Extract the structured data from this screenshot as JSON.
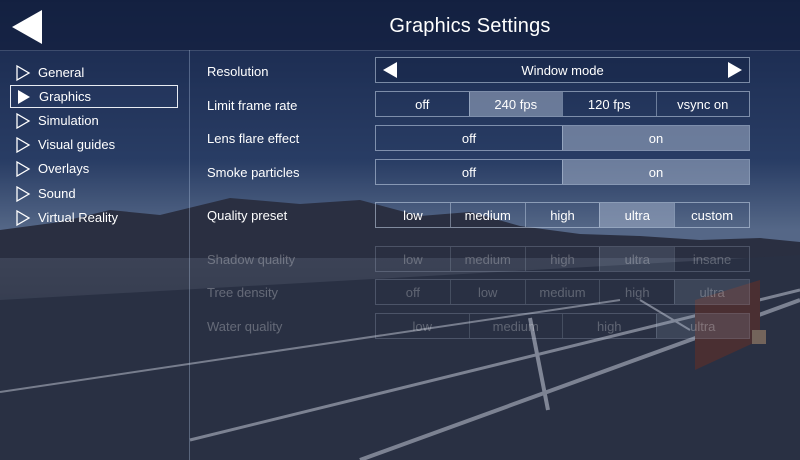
{
  "header": {
    "title": "Graphics Settings",
    "back_icon": "back-arrow-icon"
  },
  "sidebar": {
    "items": [
      {
        "label": "General",
        "selected": false
      },
      {
        "label": "Graphics",
        "selected": true
      },
      {
        "label": "Simulation",
        "selected": false
      },
      {
        "label": "Visual guides",
        "selected": false
      },
      {
        "label": "Overlays",
        "selected": false
      },
      {
        "label": "Sound",
        "selected": false
      },
      {
        "label": "Virtual Reality",
        "selected": false
      }
    ]
  },
  "settings": {
    "resolution": {
      "label": "Resolution",
      "value": "Window mode",
      "prev_icon": "left-arrow-icon",
      "next_icon": "right-arrow-icon"
    },
    "frame_rate": {
      "label": "Limit frame rate",
      "options": [
        "off",
        "240 fps",
        "120 fps",
        "vsync on"
      ],
      "selected": "240 fps"
    },
    "lens_flare": {
      "label": "Lens flare effect",
      "options": [
        "off",
        "on"
      ],
      "selected": "on"
    },
    "smoke": {
      "label": "Smoke particles",
      "options": [
        "off",
        "on"
      ],
      "selected": "on"
    },
    "quality_preset": {
      "label": "Quality preset",
      "options": [
        "low",
        "medium",
        "high",
        "ultra",
        "custom"
      ],
      "selected": "ultra"
    },
    "shadow_quality": {
      "label": "Shadow quality",
      "options": [
        "low",
        "medium",
        "high",
        "ultra",
        "insane"
      ],
      "selected": "ultra",
      "disabled": true
    },
    "tree_density": {
      "label": "Tree density",
      "options": [
        "off",
        "low",
        "medium",
        "high",
        "ultra"
      ],
      "selected": "ultra",
      "disabled": true
    },
    "water_quality": {
      "label": "Water quality",
      "options": [
        "low",
        "medium",
        "high",
        "ultra"
      ],
      "selected": "ultra",
      "disabled": true
    }
  },
  "colors": {
    "header_bg": "#101c38",
    "panel_tint": "#162444",
    "selected_option": "#96a5be",
    "text": "#ffffff"
  }
}
